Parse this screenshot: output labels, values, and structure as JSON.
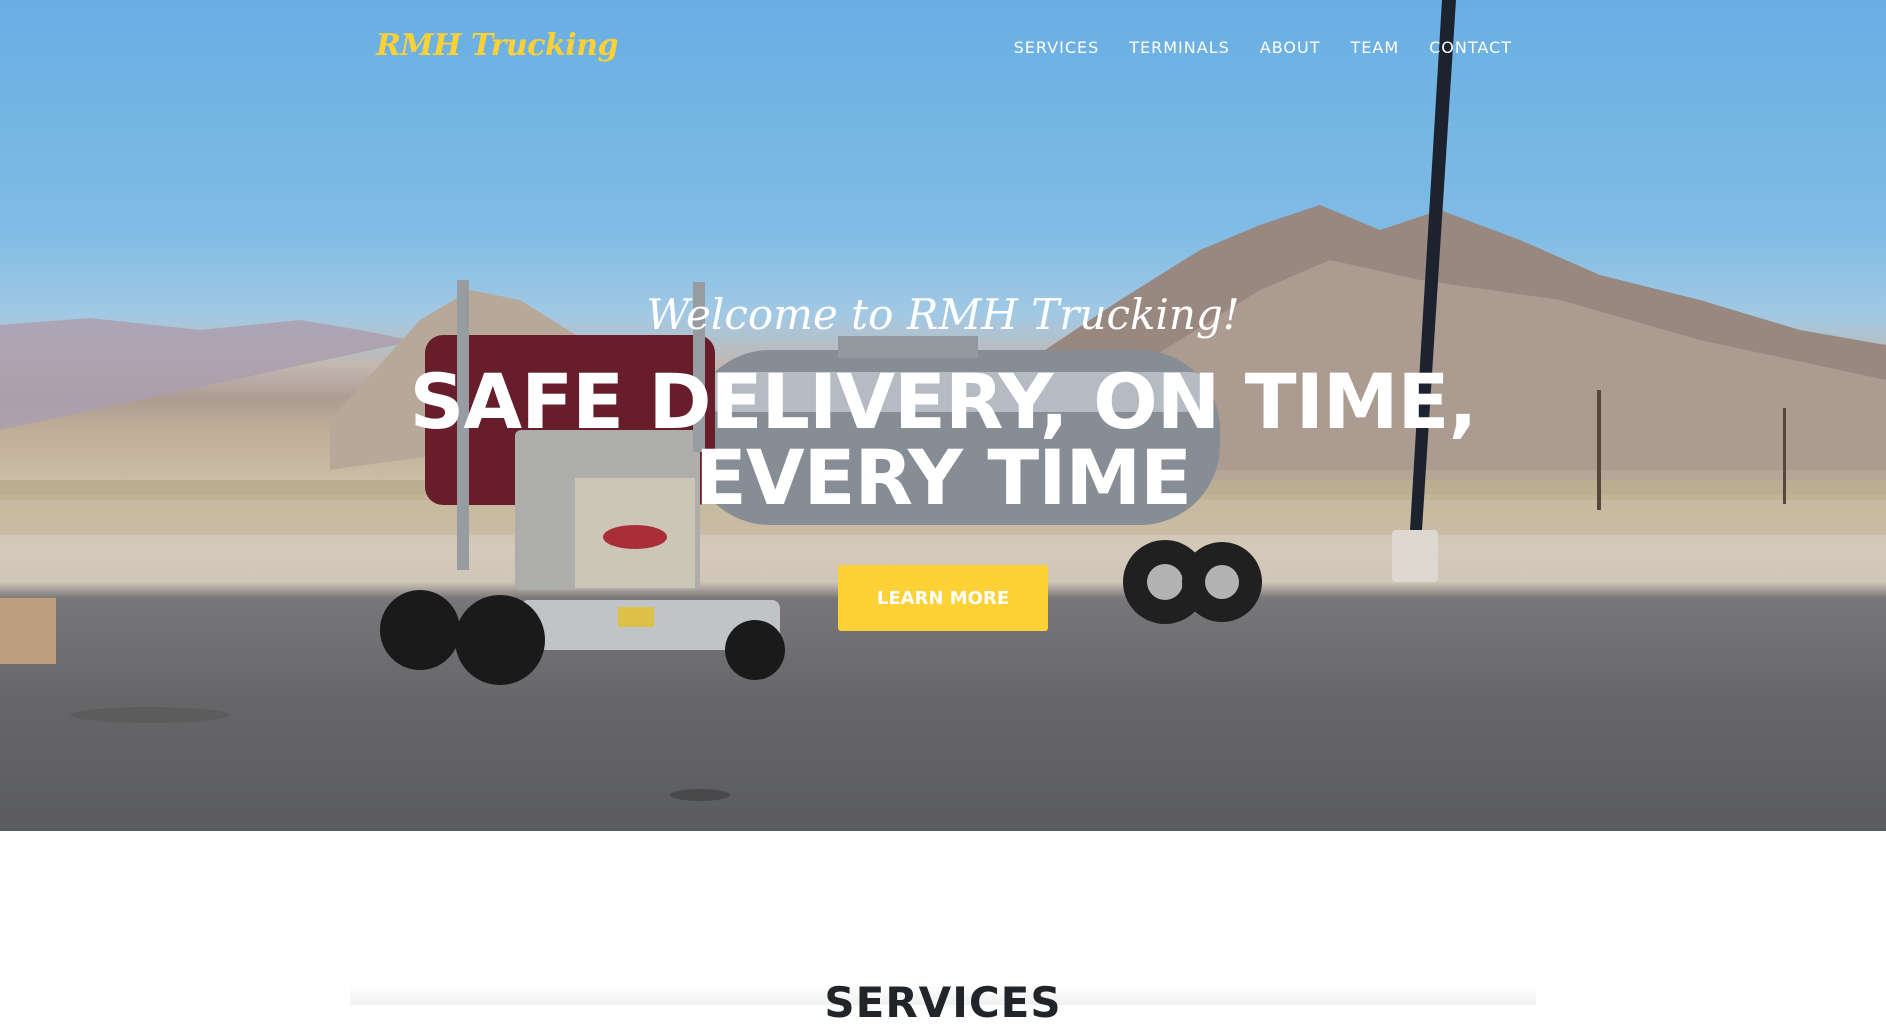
{
  "navbar": {
    "brand": "RMH Trucking",
    "items": [
      "SERVICES",
      "TERMINALS",
      "ABOUT",
      "TEAM",
      "CONTACT"
    ]
  },
  "hero": {
    "lead": "Welcome to RMH Trucking!",
    "heading": "SAFE DELIVERY, ON TIME, EVERY TIME",
    "button": "LEARN MORE"
  },
  "services": {
    "title": "SERVICES"
  },
  "colors": {
    "accent": "#fed136",
    "heading_dark": "#212529",
    "nav_text": "#ffffff"
  }
}
